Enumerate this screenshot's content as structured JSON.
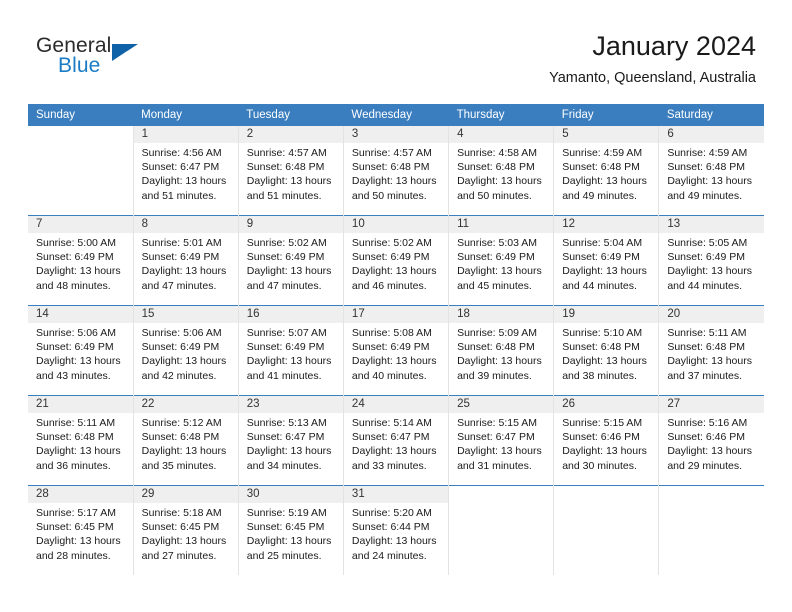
{
  "brand": {
    "name_part1": "General",
    "name_part2": "Blue",
    "triangle_color": "#0f62a8",
    "blue_color": "#1b7bc4"
  },
  "header": {
    "title": "January 2024",
    "subtitle": "Yamanto, Queensland, Australia"
  },
  "theme": {
    "header_row_bg": "#3a7ebf",
    "daynum_band_bg": "#efefef",
    "row_divider": "#3a7ebf",
    "cell_divider": "#e3e3e3"
  },
  "weekdays": [
    "Sunday",
    "Monday",
    "Tuesday",
    "Wednesday",
    "Thursday",
    "Friday",
    "Saturday"
  ],
  "weeks": [
    [
      {
        "day": "",
        "sunrise": "",
        "sunset": "",
        "daylight_line1": "",
        "daylight_line2": ""
      },
      {
        "day": "1",
        "sunrise": "Sunrise: 4:56 AM",
        "sunset": "Sunset: 6:47 PM",
        "daylight_line1": "Daylight: 13 hours",
        "daylight_line2": "and 51 minutes."
      },
      {
        "day": "2",
        "sunrise": "Sunrise: 4:57 AM",
        "sunset": "Sunset: 6:48 PM",
        "daylight_line1": "Daylight: 13 hours",
        "daylight_line2": "and 51 minutes."
      },
      {
        "day": "3",
        "sunrise": "Sunrise: 4:57 AM",
        "sunset": "Sunset: 6:48 PM",
        "daylight_line1": "Daylight: 13 hours",
        "daylight_line2": "and 50 minutes."
      },
      {
        "day": "4",
        "sunrise": "Sunrise: 4:58 AM",
        "sunset": "Sunset: 6:48 PM",
        "daylight_line1": "Daylight: 13 hours",
        "daylight_line2": "and 50 minutes."
      },
      {
        "day": "5",
        "sunrise": "Sunrise: 4:59 AM",
        "sunset": "Sunset: 6:48 PM",
        "daylight_line1": "Daylight: 13 hours",
        "daylight_line2": "and 49 minutes."
      },
      {
        "day": "6",
        "sunrise": "Sunrise: 4:59 AM",
        "sunset": "Sunset: 6:48 PM",
        "daylight_line1": "Daylight: 13 hours",
        "daylight_line2": "and 49 minutes."
      }
    ],
    [
      {
        "day": "7",
        "sunrise": "Sunrise: 5:00 AM",
        "sunset": "Sunset: 6:49 PM",
        "daylight_line1": "Daylight: 13 hours",
        "daylight_line2": "and 48 minutes."
      },
      {
        "day": "8",
        "sunrise": "Sunrise: 5:01 AM",
        "sunset": "Sunset: 6:49 PM",
        "daylight_line1": "Daylight: 13 hours",
        "daylight_line2": "and 47 minutes."
      },
      {
        "day": "9",
        "sunrise": "Sunrise: 5:02 AM",
        "sunset": "Sunset: 6:49 PM",
        "daylight_line1": "Daylight: 13 hours",
        "daylight_line2": "and 47 minutes."
      },
      {
        "day": "10",
        "sunrise": "Sunrise: 5:02 AM",
        "sunset": "Sunset: 6:49 PM",
        "daylight_line1": "Daylight: 13 hours",
        "daylight_line2": "and 46 minutes."
      },
      {
        "day": "11",
        "sunrise": "Sunrise: 5:03 AM",
        "sunset": "Sunset: 6:49 PM",
        "daylight_line1": "Daylight: 13 hours",
        "daylight_line2": "and 45 minutes."
      },
      {
        "day": "12",
        "sunrise": "Sunrise: 5:04 AM",
        "sunset": "Sunset: 6:49 PM",
        "daylight_line1": "Daylight: 13 hours",
        "daylight_line2": "and 44 minutes."
      },
      {
        "day": "13",
        "sunrise": "Sunrise: 5:05 AM",
        "sunset": "Sunset: 6:49 PM",
        "daylight_line1": "Daylight: 13 hours",
        "daylight_line2": "and 44 minutes."
      }
    ],
    [
      {
        "day": "14",
        "sunrise": "Sunrise: 5:06 AM",
        "sunset": "Sunset: 6:49 PM",
        "daylight_line1": "Daylight: 13 hours",
        "daylight_line2": "and 43 minutes."
      },
      {
        "day": "15",
        "sunrise": "Sunrise: 5:06 AM",
        "sunset": "Sunset: 6:49 PM",
        "daylight_line1": "Daylight: 13 hours",
        "daylight_line2": "and 42 minutes."
      },
      {
        "day": "16",
        "sunrise": "Sunrise: 5:07 AM",
        "sunset": "Sunset: 6:49 PM",
        "daylight_line1": "Daylight: 13 hours",
        "daylight_line2": "and 41 minutes."
      },
      {
        "day": "17",
        "sunrise": "Sunrise: 5:08 AM",
        "sunset": "Sunset: 6:49 PM",
        "daylight_line1": "Daylight: 13 hours",
        "daylight_line2": "and 40 minutes."
      },
      {
        "day": "18",
        "sunrise": "Sunrise: 5:09 AM",
        "sunset": "Sunset: 6:48 PM",
        "daylight_line1": "Daylight: 13 hours",
        "daylight_line2": "and 39 minutes."
      },
      {
        "day": "19",
        "sunrise": "Sunrise: 5:10 AM",
        "sunset": "Sunset: 6:48 PM",
        "daylight_line1": "Daylight: 13 hours",
        "daylight_line2": "and 38 minutes."
      },
      {
        "day": "20",
        "sunrise": "Sunrise: 5:11 AM",
        "sunset": "Sunset: 6:48 PM",
        "daylight_line1": "Daylight: 13 hours",
        "daylight_line2": "and 37 minutes."
      }
    ],
    [
      {
        "day": "21",
        "sunrise": "Sunrise: 5:11 AM",
        "sunset": "Sunset: 6:48 PM",
        "daylight_line1": "Daylight: 13 hours",
        "daylight_line2": "and 36 minutes."
      },
      {
        "day": "22",
        "sunrise": "Sunrise: 5:12 AM",
        "sunset": "Sunset: 6:48 PM",
        "daylight_line1": "Daylight: 13 hours",
        "daylight_line2": "and 35 minutes."
      },
      {
        "day": "23",
        "sunrise": "Sunrise: 5:13 AM",
        "sunset": "Sunset: 6:47 PM",
        "daylight_line1": "Daylight: 13 hours",
        "daylight_line2": "and 34 minutes."
      },
      {
        "day": "24",
        "sunrise": "Sunrise: 5:14 AM",
        "sunset": "Sunset: 6:47 PM",
        "daylight_line1": "Daylight: 13 hours",
        "daylight_line2": "and 33 minutes."
      },
      {
        "day": "25",
        "sunrise": "Sunrise: 5:15 AM",
        "sunset": "Sunset: 6:47 PM",
        "daylight_line1": "Daylight: 13 hours",
        "daylight_line2": "and 31 minutes."
      },
      {
        "day": "26",
        "sunrise": "Sunrise: 5:15 AM",
        "sunset": "Sunset: 6:46 PM",
        "daylight_line1": "Daylight: 13 hours",
        "daylight_line2": "and 30 minutes."
      },
      {
        "day": "27",
        "sunrise": "Sunrise: 5:16 AM",
        "sunset": "Sunset: 6:46 PM",
        "daylight_line1": "Daylight: 13 hours",
        "daylight_line2": "and 29 minutes."
      }
    ],
    [
      {
        "day": "28",
        "sunrise": "Sunrise: 5:17 AM",
        "sunset": "Sunset: 6:45 PM",
        "daylight_line1": "Daylight: 13 hours",
        "daylight_line2": "and 28 minutes."
      },
      {
        "day": "29",
        "sunrise": "Sunrise: 5:18 AM",
        "sunset": "Sunset: 6:45 PM",
        "daylight_line1": "Daylight: 13 hours",
        "daylight_line2": "and 27 minutes."
      },
      {
        "day": "30",
        "sunrise": "Sunrise: 5:19 AM",
        "sunset": "Sunset: 6:45 PM",
        "daylight_line1": "Daylight: 13 hours",
        "daylight_line2": "and 25 minutes."
      },
      {
        "day": "31",
        "sunrise": "Sunrise: 5:20 AM",
        "sunset": "Sunset: 6:44 PM",
        "daylight_line1": "Daylight: 13 hours",
        "daylight_line2": "and 24 minutes."
      },
      {
        "day": "",
        "sunrise": "",
        "sunset": "",
        "daylight_line1": "",
        "daylight_line2": ""
      },
      {
        "day": "",
        "sunrise": "",
        "sunset": "",
        "daylight_line1": "",
        "daylight_line2": ""
      },
      {
        "day": "",
        "sunrise": "",
        "sunset": "",
        "daylight_line1": "",
        "daylight_line2": ""
      }
    ]
  ]
}
